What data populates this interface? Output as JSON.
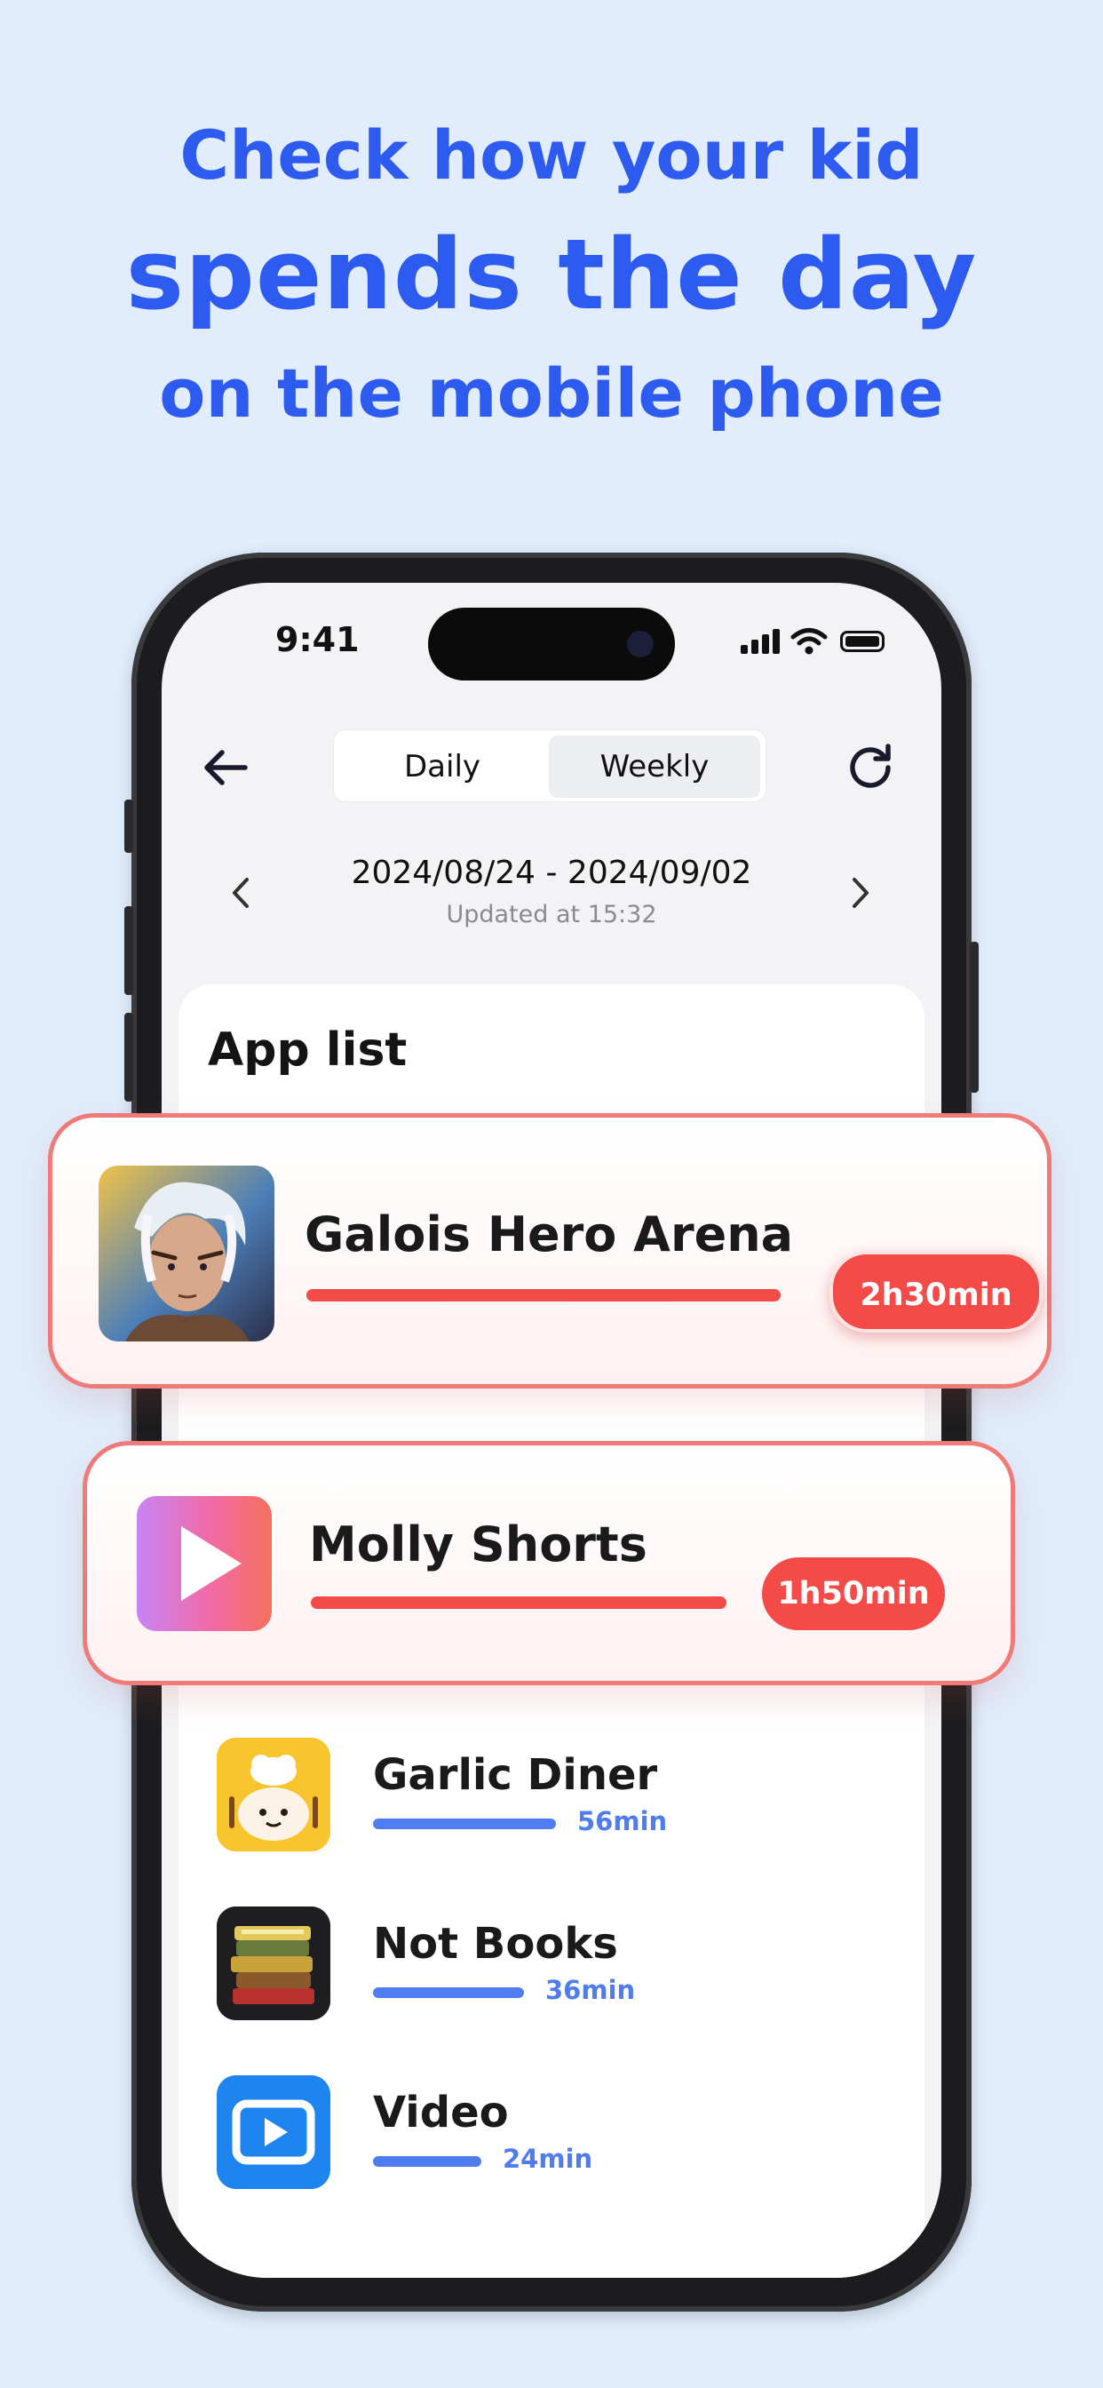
{
  "headline": {
    "line1": "Check how your kid",
    "line2": "spends the day",
    "line3": "on the mobile phone"
  },
  "status_bar": {
    "time": "9:41",
    "icons": [
      "cellular-signal-icon",
      "wifi-icon",
      "battery-icon"
    ]
  },
  "nav": {
    "back_icon": "arrow-left-icon",
    "refresh_icon": "refresh-icon",
    "tabs": [
      {
        "label": "Daily",
        "selected": false
      },
      {
        "label": "Weekly",
        "selected": true
      }
    ]
  },
  "date": {
    "range": "2024/08/24 - 2024/09/02",
    "updated": "Updated at 15:32",
    "prev_icon": "chevron-left-icon",
    "next_icon": "chevron-right-icon"
  },
  "app_list": {
    "title": "App list",
    "highlighted": [
      {
        "name": "Galois Hero Arena",
        "duration": "2h30min",
        "minutes": 150,
        "icon": "hero-portrait-icon"
      },
      {
        "name": "Molly Shorts",
        "duration": "1h50min",
        "minutes": 110,
        "icon": "play-gradient-icon"
      }
    ],
    "items": [
      {
        "name": "Garlic Diner",
        "duration": "56min",
        "minutes": 56,
        "icon": "chef-garlic-icon"
      },
      {
        "name": "Not Books",
        "duration": "36min",
        "minutes": 36,
        "icon": "book-stack-icon"
      },
      {
        "name": "Video",
        "duration": "24min",
        "minutes": 24,
        "icon": "video-play-icon"
      }
    ]
  },
  "colors": {
    "background": "#e1edfc",
    "headline": "#2d5bf0",
    "highlight_red": "#f44a48",
    "bar_blue": "#4f7df0"
  }
}
